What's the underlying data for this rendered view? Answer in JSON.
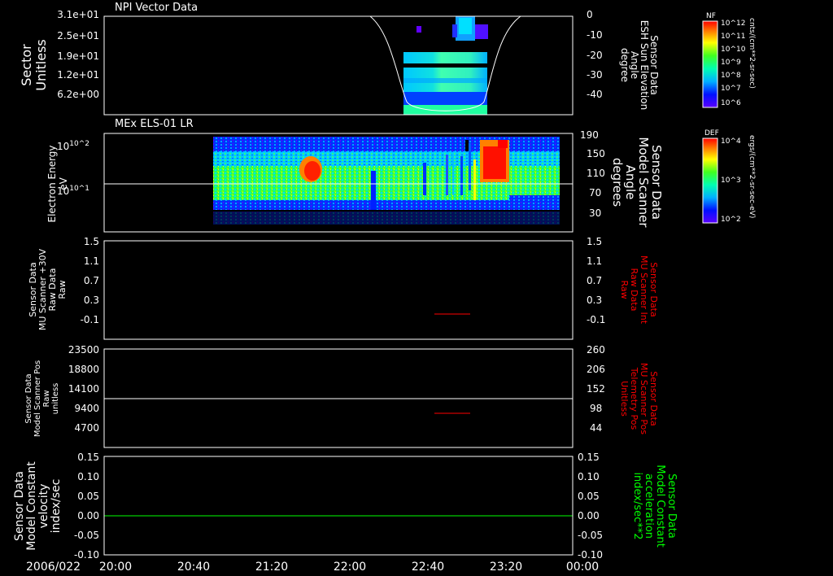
{
  "date_label": "2006/022",
  "x_ticks": [
    "20:00",
    "20:40",
    "21:20",
    "22:00",
    "22:40",
    "23:20",
    "00:00"
  ],
  "colors": {
    "axis": "#ffffff",
    "red": "#ff0000",
    "green": "#00ff00",
    "background": "#000000"
  },
  "chart_data": [
    {
      "type": "heatmap",
      "title": "NPI Vector Data",
      "ylabel": [
        "Sector",
        "Unitless"
      ],
      "yticks": [
        "3.1e+01",
        "2.5e+01",
        "1.9e+01",
        "1.2e+01",
        "6.2e+00"
      ],
      "y2label": [
        "Sensor Data",
        "ESH Sun Elevation",
        "Angle",
        "degree"
      ],
      "y2ticks": [
        "0",
        "-10",
        "-20",
        "-30",
        "-40"
      ],
      "overlay_line": {
        "name": "ESH Sun Elevation",
        "start": "22:30",
        "end": "23:00",
        "min_value": -45
      },
      "colorbar": {
        "label": "NF",
        "unit": "cnts/(cm**2-sr-sec)",
        "ticks": [
          "10^12",
          "10^11",
          "10^10",
          "10^9",
          "10^8",
          "10^7",
          "10^6"
        ]
      }
    },
    {
      "type": "heatmap",
      "title": "MEx ELS-01 LR",
      "ylabel": [
        "Electron Energy",
        "eV"
      ],
      "yticks": [
        "10^2",
        "10^1"
      ],
      "yscale": "log",
      "y2label": [
        "Sensor Data",
        "Model Scanner",
        "Angle",
        "degrees"
      ],
      "y2ticks": [
        "190",
        "150",
        "110",
        "70",
        "30"
      ],
      "overlay_value_y2": 90,
      "data_start": "20:55",
      "data_end": "23:45",
      "colorbar": {
        "label": "DEF",
        "unit": "ergs/(cm**2-sr-sec-eV)",
        "ticks": [
          "10^4",
          "10^3",
          "10^2"
        ]
      }
    },
    {
      "type": "line",
      "ylabel": [
        "Sensor Data",
        "MU Scanner +30V",
        "Raw Data",
        "Raw"
      ],
      "yticks": [
        "1.5",
        "1.1",
        "0.7",
        "0.3",
        "-0.1"
      ],
      "ylim": [
        -0.3,
        1.5
      ],
      "y2label": [
        "Sensor Data",
        "MU Scanner Int",
        "Raw Data",
        "Raw"
      ],
      "y2ticks": [
        "1.5",
        "1.1",
        "0.7",
        "0.3",
        "-0.1"
      ],
      "series": [
        {
          "color": "#ff0000",
          "x_start": "22:45",
          "x_end": "23:00",
          "value": -0.05
        }
      ]
    },
    {
      "type": "line",
      "ylabel": [
        "Sensor Data",
        "Model Scanner Pos",
        "Raw",
        "unitless"
      ],
      "yticks": [
        "23500",
        "18800",
        "14100",
        "9400",
        "4700"
      ],
      "ylim": [
        0,
        23500
      ],
      "y2label": [
        "Sensor Data",
        "MU Scanner Pos",
        "Telemetry Pos",
        "Unitless"
      ],
      "y2ticks": [
        "260",
        "206",
        "152",
        "98",
        "44"
      ],
      "y2lim": [
        0,
        260
      ],
      "series": [
        {
          "color": "#ffffff",
          "x_start": "20:00",
          "x_end": "00:00",
          "value": 11750
        },
        {
          "color": "#ff0000",
          "x_start": "22:45",
          "x_end": "23:00",
          "value_y2": 90
        }
      ]
    },
    {
      "type": "line",
      "ylabel": [
        "Sensor Data",
        "Model Constant",
        "velocity",
        "index/sec"
      ],
      "yticks": [
        "0.15",
        "0.10",
        "0.05",
        "0.00",
        "-0.05",
        "-0.10"
      ],
      "ylim": [
        -0.1,
        0.15
      ],
      "y2label": [
        "Sensor Data",
        "Model Constant",
        "acceleration",
        "index/sec**2"
      ],
      "y2ticks": [
        "0.15",
        "0.10",
        "0.05",
        "0.00",
        "-0.05",
        "-0.10"
      ],
      "series": [
        {
          "color": "#00ff00",
          "x_start": "20:00",
          "x_end": "00:00",
          "value": 0.0
        }
      ]
    }
  ]
}
